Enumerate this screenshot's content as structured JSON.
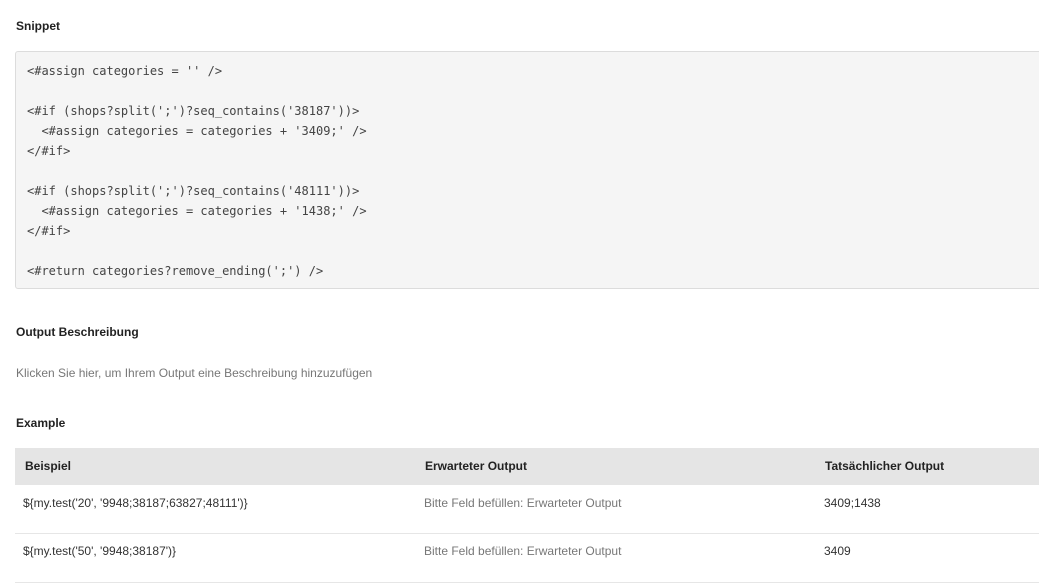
{
  "snippet": {
    "title": "Snippet",
    "code_lines": [
      "<#assign categories = '' />",
      "",
      "<#if (shops?split(';')?seq_contains('38187'))>",
      "  <#assign categories = categories + '3409;' />",
      "</#if>",
      "",
      "<#if (shops?split(';')?seq_contains('48111'))>",
      "  <#assign categories = categories + '1438;' />",
      "</#if>",
      "",
      "<#return categories?remove_ending(';') />"
    ]
  },
  "output_description": {
    "title": "Output Beschreibung",
    "placeholder": "Klicken Sie hier, um Ihrem Output eine Beschreibung hinzuzufügen"
  },
  "example": {
    "title": "Example",
    "columns": [
      "Beispiel",
      "Erwarteter Output",
      "Tatsächlicher Output"
    ],
    "rows": [
      {
        "example": "${my.test('20', '9948;38187;63827;48111')}",
        "expected": "Bitte Feld befüllen: Erwarteter Output",
        "actual": "3409;1438"
      },
      {
        "example": "${my.test('50', '9948;38187')}",
        "expected": "Bitte Feld befüllen: Erwarteter Output",
        "actual": "3409"
      }
    ]
  }
}
